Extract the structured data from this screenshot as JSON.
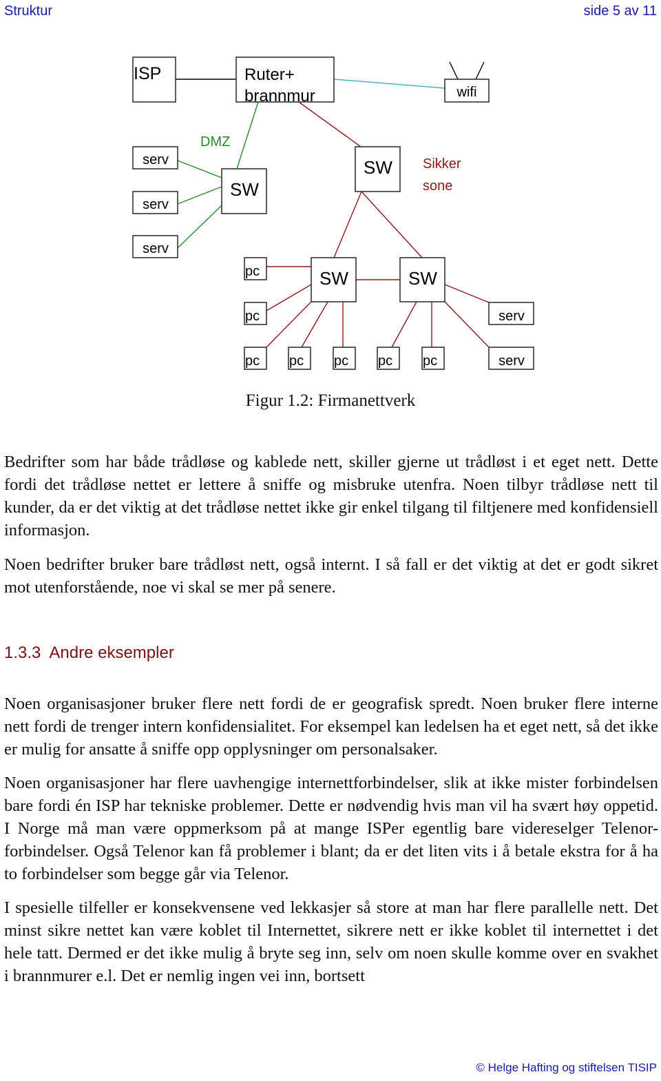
{
  "header": {
    "section_name": "Struktur",
    "page_indicator": "side 5 av 11"
  },
  "figure": {
    "caption": "Figur 1.2: Firmanettverk",
    "colors": {
      "dmz": "#2a8a2a",
      "secure": "#8b1a1a",
      "wifi_link": "#3cb4b4",
      "internet_link": "#000000"
    },
    "nodes": {
      "isp": "ISP",
      "router_line1": "Ruter+",
      "router_line2": "brannmur",
      "wifi": "wifi",
      "dmz_label": "DMZ",
      "dmz_switch": "SW",
      "dmz_servers": [
        "serv",
        "serv",
        "serv"
      ],
      "secure_label_line1": "Sikker",
      "secure_label_line2": "sone",
      "top_switch": "SW",
      "left_switch": "SW",
      "right_switch": "SW",
      "left_pcs": [
        "pc",
        "pc",
        "pc",
        "pc",
        "pc"
      ],
      "right_pcs": [
        "pc",
        "pc"
      ],
      "right_servers": [
        "serv",
        "serv"
      ]
    }
  },
  "paragraphs_before": [
    "Bedrifter som har både trådløse og kablede nett, skiller gjerne ut trådløst i et eget nett. Dette fordi det trådløse nettet er lettere å sniffe og misbruke utenfra. Noen tilbyr trådløse nett til kunder, da er det viktig at det trådløse nettet ikke gir enkel tilgang til filtjenere med konfidensiell informasjon.",
    "Noen bedrifter bruker bare trådløst nett, også internt. I så fall er det viktig at det er godt sikret mot utenforstående, noe vi skal se mer på senere."
  ],
  "section": {
    "number": "1.3.3",
    "title": "Andre eksempler"
  },
  "paragraphs_after": [
    "Noen organisasjoner bruker flere nett fordi de er geografisk spredt. Noen bruker flere interne nett fordi de trenger intern konfidensialitet. For eksempel kan ledelsen ha et eget nett, så det ikke er mulig for ansatte å sniffe opp opplysninger om personalsaker.",
    "Noen organisasjoner har flere uavhengige internettforbindelser, slik at ikke mister forbindelsen bare fordi én ISP har tekniske problemer. Dette er nødvendig hvis man vil ha svært høy oppetid. I Norge må man være oppmerksom på at mange ISPer egentlig bare videreselger Telenor-forbindelser. Også Telenor kan få problemer i blant; da er det liten vits i å betale ekstra for å ha to forbindelser som begge går via Telenor.",
    "I spesielle tilfeller er konsekvensene ved lekkasjer så store at man har flere parallelle nett. Det minst sikre nettet kan være koblet til Internettet, sikrere nett er ikke koblet til internettet i det hele tatt. Dermed er det ikke mulig å bryte seg inn, selv om noen skulle komme over en svakhet i brannmurer e.l. Det er nemlig ingen vei inn, bortsett"
  ],
  "footer": {
    "copyright": "© Helge Hafting og stiftelsen TISIP"
  }
}
